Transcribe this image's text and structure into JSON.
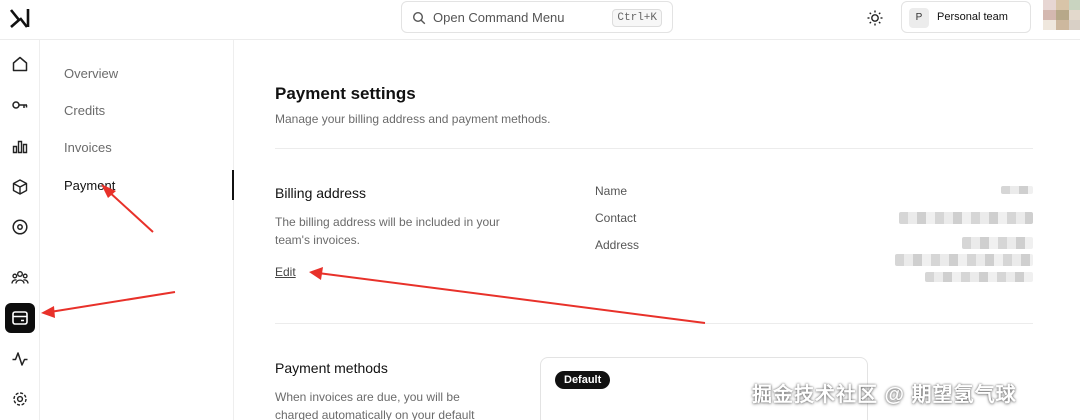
{
  "topbar": {
    "command_label": "Open Command Menu",
    "command_shortcut": "Ctrl+K",
    "team_initial": "P",
    "team_name": "Personal team"
  },
  "rail": {
    "icons": [
      "home-icon",
      "key-icon",
      "bar-chart-icon",
      "cube-icon",
      "compass-icon",
      "users-icon",
      "billing-icon",
      "activity-icon",
      "settings-icon"
    ],
    "active": "billing-icon"
  },
  "subnav": {
    "items": [
      {
        "label": "Overview"
      },
      {
        "label": "Credits"
      },
      {
        "label": "Invoices"
      },
      {
        "label": "Payment"
      }
    ],
    "active": "Payment"
  },
  "main": {
    "title": "Payment settings",
    "subtitle": "Manage your billing address and payment methods.",
    "billing": {
      "title": "Billing address",
      "desc": "The billing address will be included in your team's invoices.",
      "edit_label": "Edit",
      "fields": [
        {
          "label": "Name"
        },
        {
          "label": "Contact"
        },
        {
          "label": "Address"
        }
      ]
    },
    "payment_methods": {
      "title": "Payment methods",
      "desc": "When invoices are due, you will be charged automatically on your default",
      "badge": "Default"
    }
  },
  "watermark": "掘金技术社区 @ 期望氢气球",
  "colors": {
    "accent": "#0d0d0d",
    "annotation_arrow": "#e8312a"
  }
}
